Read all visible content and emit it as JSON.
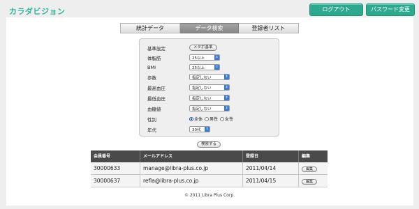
{
  "header": {
    "logo": "カラダビジョン",
    "logout_label": "ログアウト",
    "password_change_label": "パスワード変更"
  },
  "tabs": [
    {
      "label": "統計データ",
      "active": false
    },
    {
      "label": "データ検索",
      "active": true
    },
    {
      "label": "登録者リスト",
      "active": false
    }
  ],
  "filters": {
    "base_setting": {
      "label": "基準設定",
      "button": "メタボ基準"
    },
    "body_fat": {
      "label": "体脂肪",
      "value": "25以上"
    },
    "bmi": {
      "label": "BMI",
      "value": "25以上"
    },
    "steps": {
      "label": "歩数",
      "value": "指定しない"
    },
    "max_bp": {
      "label": "最高血圧",
      "value": "指定しない"
    },
    "min_bp": {
      "label": "最低血圧",
      "value": "指定しない"
    },
    "blood_sugar": {
      "label": "血糖値",
      "value": "指定しない"
    },
    "gender": {
      "label": "性別",
      "options": [
        "全体",
        "男性",
        "女性"
      ],
      "selected": "全体"
    },
    "age": {
      "label": "年代",
      "value": "30代"
    }
  },
  "search_label": "検索する",
  "table": {
    "headers": [
      "会員番号",
      "メールアドレス",
      "登録日",
      "編集"
    ],
    "rows": [
      {
        "id": "30000633",
        "email": "manage@libra-plus.co.jp",
        "date": "2011/04/14",
        "edit": "編集"
      },
      {
        "id": "30000637",
        "email": "refla@libra-plus.co.jp",
        "date": "2011/04/15",
        "edit": "編集"
      }
    ]
  },
  "footer": "© 2011 Libra Plus Corp."
}
